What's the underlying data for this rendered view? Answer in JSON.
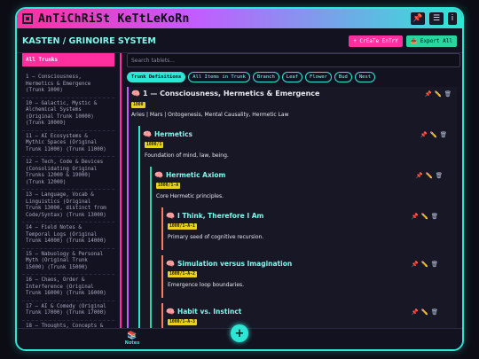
{
  "app": {
    "title": "AnTiChRiSt KeTtLeKoRn",
    "title_icons": [
      "pin-icon",
      "menu-icon",
      "info-icon"
    ],
    "title_glyphs": [
      "📌",
      "☰",
      "i"
    ]
  },
  "header": {
    "system_title": "KASTEN / GRINOIRE SYSTEM",
    "create_label": "+ CrEaTe EnTrY",
    "export_label": "📤 Export All"
  },
  "sidebar": {
    "all_label": "All Trunks",
    "items": [
      "1 — Consciousness,\nHermetics & Emergence\n(Trunk 1000)",
      "10 — Galactic, Mystic &\nAlchemical Systems\n(Original Trunk 10000)\n(Trunk 10000)",
      "11 — AI Ecosystems &\nMythic Spaces (Original\nTrunk 11000) (Trunk 11000)",
      "12 — Tech, Code & Devices\n(Consolidating Original\nTrunks 12000 & 19000)\n(Trunk 12000)",
      "13 — Language, Vocab &\nLinguistics (Original\nTrunk 13000, distinct from\nCode/Syntax) (Trunk 13000)",
      "14 — Field Notes &\nTemporal Logs (Original\nTrunk 14000) (Trunk 14000)",
      "15 — Nabuology & Personal\nMyth (Original Trunk\n15000) (Trunk 15000)",
      "16 — Chaos, Order &\nInterference (Original\nTrunk 16000) (Trunk 16000)",
      "17 — AI & Comedy (Original\nTrunk 17000) (Trunk 17000)",
      "18 — Thoughts, Concepts &"
    ]
  },
  "main": {
    "search_placeholder": "Search tablets...",
    "filters": [
      "Trunk Definitions",
      "All Items in Trunk",
      "Branch",
      "Leaf",
      "Flower",
      "Bud",
      "Nest"
    ],
    "active_filter": "Trunk Definitions",
    "nodes": [
      {
        "title": "1 — Consciousness, Hermetics & Emergence",
        "badge": "1000",
        "desc": "Aries | Mars | Ontogenesis, Mental Causality, Hermetic Law",
        "bar_color": "#c35cff"
      },
      {
        "title": "Hermetics",
        "badge": "1000/1",
        "desc": "Foundation of mind, law, being.",
        "bar_color": "#2ee6d6"
      },
      {
        "title": "Hermetic Axiom",
        "badge": "1000/1-A",
        "desc": "Core Hermetic principles.",
        "bar_color": "#29d6a0"
      },
      {
        "title": "I Think, Therefore I Am",
        "badge": "1000/1-A-1",
        "desc": "Primary seed of cognitive recursion.",
        "bar_color": "#ff7a59"
      },
      {
        "title": "Simulation versus Imagination",
        "badge": "1000/1-A-2",
        "desc": "Emergence loop boundaries.",
        "bar_color": "#ff7a59"
      },
      {
        "title": "Habit vs. Instinct",
        "badge": "1000/1-A-3",
        "desc": "",
        "bar_color": "#ff7a59"
      }
    ]
  },
  "bottom": {
    "notes_label": "Notes",
    "fab_label": "+"
  },
  "colors": {
    "accent_cyan": "#2ee6d6",
    "accent_pink": "#ff2fa0",
    "badge_yellow": "#e9d21a"
  }
}
